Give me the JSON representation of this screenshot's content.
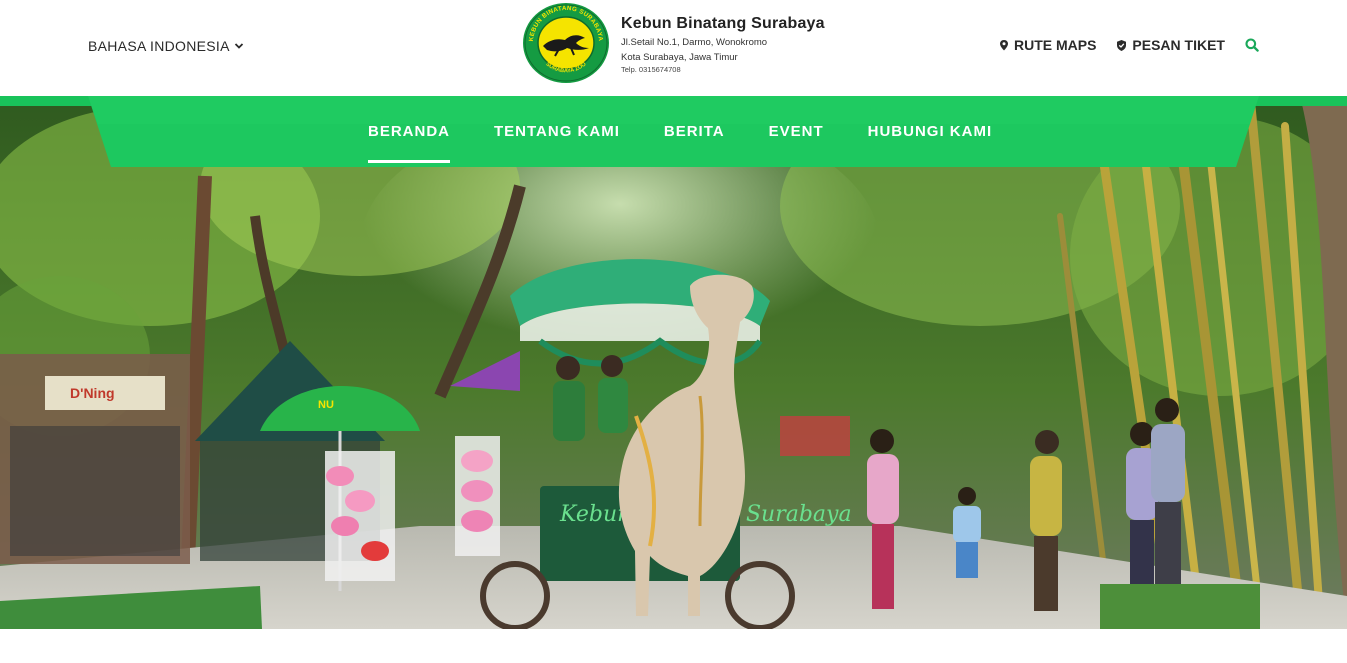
{
  "header": {
    "language": "BAHASA INDONESIA",
    "brand": {
      "name": "Kebun Binatang Surabaya",
      "address_line1": "Jl.Setail No.1, Darmo, Wonokromo",
      "address_line2": "Kota Surabaya, Jawa Timur",
      "phone": "Telp. 0315674708",
      "logo_ring_top": "KEBUN BINATANG SURABAYA",
      "logo_ring_bottom": "SURABAYA ZOO"
    },
    "links": {
      "maps": "RUTE MAPS",
      "ticket": "PESAN TIKET"
    },
    "icons": {
      "maps": "map-pin-icon",
      "ticket": "shield-icon",
      "search": "search-icon",
      "language": "chevron-down-icon"
    }
  },
  "nav": {
    "items": [
      {
        "label": "BERANDA",
        "active": true
      },
      {
        "label": "TENTANG KAMI",
        "active": false
      },
      {
        "label": "BERITA",
        "active": false
      },
      {
        "label": "EVENT",
        "active": false
      },
      {
        "label": "HUBUNGI KAMI",
        "active": false
      }
    ]
  },
  "hero": {
    "cart_sign": "Kebun Binatang Surabaya",
    "umbrella_text": "NU",
    "stall_sign": "D'Ning"
  },
  "colors": {
    "brand_green": "#19c35a",
    "nav_green": "#1dc85f",
    "search_icon": "#1aa85a",
    "logo_yellow": "#f5e400",
    "logo_green": "#159b42"
  }
}
